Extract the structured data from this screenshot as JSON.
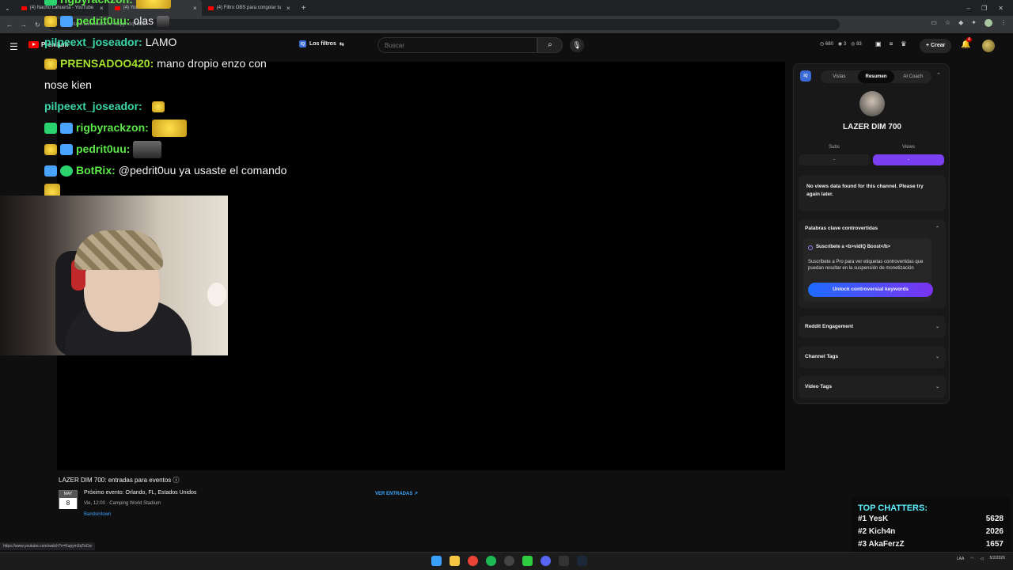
{
  "browser": {
    "tabs": [
      {
        "label": "(4) Nacho Lahuerta - YouTube"
      },
      {
        "label": "(4) YouTube"
      },
      {
        "label": "(4) Filtro OBS para congelar tu"
      }
    ],
    "url": "youtube.com/watch?v=Kupym3qToCw",
    "status_url": "https://www.youtube.com/watch?v=Kupym3qToCw"
  },
  "header": {
    "logo_text": "Premium",
    "filters_label": "Los filtros",
    "search_placeholder": "Buscar",
    "stats": [
      "680",
      "3",
      "83"
    ],
    "create_label": "Crear",
    "notif_count": "4"
  },
  "chat": [
    {
      "name": "rigbyrackzon:",
      "name_color": "#5de84a",
      "text": ""
    },
    {
      "name": "pedrit0uu:",
      "name_color": "#5de84a",
      "text": "olas"
    },
    {
      "name": "pilpeext_joseador:",
      "name_color": "#3ad6a8",
      "text": "LAMO"
    },
    {
      "name": "PRENSADOO420:",
      "name_color": "#a6e22e",
      "text": "mano dropio enzo con"
    },
    {
      "name": "",
      "name_color": "#ffffff",
      "text": "nose kien"
    },
    {
      "name": "pilpeext_joseador:",
      "name_color": "#3ad6a8",
      "text": ""
    },
    {
      "name": "rigbyrackzon:",
      "name_color": "#5de84a",
      "text": ""
    },
    {
      "name": "pedrit0uu:",
      "name_color": "#5de84a",
      "text": ""
    },
    {
      "name": "BotRix:",
      "name_color": "#5de84a",
      "text": "@pedrit0uu ya usaste el comando"
    }
  ],
  "events": {
    "title": "LAZER DIM 700: entradas para eventos",
    "month": "MAY",
    "day": "8",
    "name": "Próximo evento: Orlando, FL, Estados Unidos",
    "time": "Vie, 12:00 · Camping World Stadium",
    "source": "Bandsintown",
    "link_label": "VER ENTRADAS"
  },
  "panel": {
    "logo": "IQ",
    "tabs": [
      "Vistas",
      "Resumen",
      "AI Coach"
    ],
    "active_tab": "Resumen",
    "channel": "LAZER DIM 700",
    "subs_label": "Subs",
    "views_label": "Views",
    "subs_value": "-",
    "views_value": "-",
    "note": "No views data found for this channel. Please try again later.",
    "keywords_title": "Palabras clave controvertidas",
    "kw_promo_title": "Suscríbete a <b>vidIQ Boost</b>",
    "kw_promo_desc": "Suscríbete a Pro para ver etiquetas controvertidas que puedan resultar en la suspensión de monetización",
    "kw_button": "Unlock controversial keywords",
    "sections": [
      "Reddit Engagement",
      "Channel Tags",
      "Video Tags"
    ]
  },
  "chatters": {
    "title": "TOP CHATTERS:",
    "rows": [
      {
        "rank": "#1",
        "name": "YesK",
        "count": "5628"
      },
      {
        "rank": "#2",
        "name": "Kich4n",
        "count": "2026"
      },
      {
        "rank": "#3",
        "name": "AkaFerzZ",
        "count": "1657"
      }
    ]
  },
  "taskbar": {
    "lang": "LAA",
    "date": "5/2/2026"
  },
  "colors": {
    "accent_purple": "#7b3ff2",
    "accent_blue": "#1e6bff",
    "youtube_red": "#ff0000",
    "chatters_title": "#5ff0ff"
  }
}
